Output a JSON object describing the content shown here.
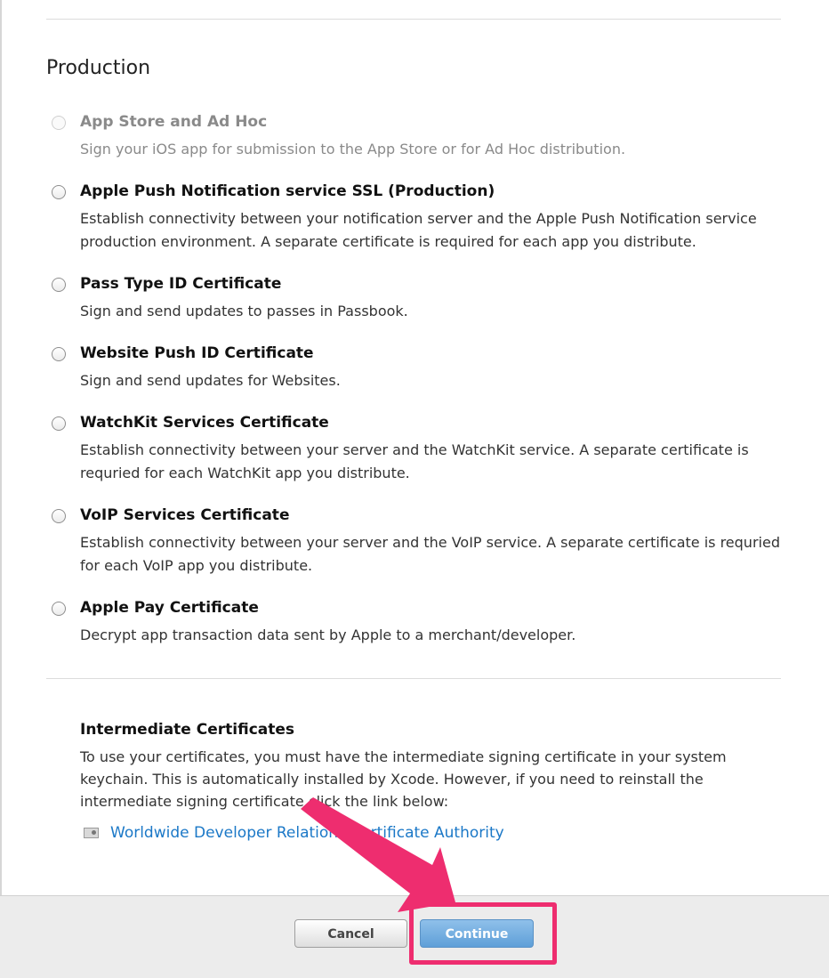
{
  "production": {
    "title": "Production",
    "options": [
      {
        "title": "App Store and Ad Hoc",
        "description": "Sign your iOS app for submission to the App Store or for Ad Hoc distribution.",
        "disabled": true,
        "selected": false
      },
      {
        "title": "Apple Push Notification service SSL (Production)",
        "description": "Establish connectivity between your notification server and the Apple Push Notification service production environment. A separate certificate is required for each app you distribute.",
        "disabled": false,
        "selected": false
      },
      {
        "title": "Pass Type ID Certificate",
        "description": "Sign and send updates to passes in Passbook.",
        "disabled": false,
        "selected": false
      },
      {
        "title": "Website Push ID Certificate",
        "description": "Sign and send updates for Websites.",
        "disabled": false,
        "selected": false
      },
      {
        "title": "WatchKit Services Certificate",
        "description": "Establish connectivity between your server and the WatchKit service. A separate certificate is requried for each WatchKit app you distribute.",
        "disabled": false,
        "selected": false
      },
      {
        "title": "VoIP Services Certificate",
        "description": "Establish connectivity between your server and the VoIP service. A separate certificate is requried for each VoIP app you distribute.",
        "disabled": false,
        "selected": false
      },
      {
        "title": "Apple Pay Certificate",
        "description": "Decrypt app transaction data sent by Apple to a merchant/developer.",
        "disabled": false,
        "selected": false
      }
    ]
  },
  "intermediate": {
    "title": "Intermediate Certificates",
    "description": "To use your certificates, you must have the intermediate signing certificate in your system keychain. This is automatically installed by Xcode. However, if you need to reinstall the intermediate signing certificate click the link below:",
    "link_icon": "certificate-icon",
    "link_text": "Worldwide Developer Relations Certificate Authority"
  },
  "footer": {
    "cancel_label": "Cancel",
    "continue_label": "Continue"
  },
  "annotation": {
    "arrow_color": "#ee2d6f",
    "highlight_color": "#ee2d6f"
  },
  "colors": {
    "link": "#1b78c7",
    "continue_button": "#6aa6db"
  }
}
